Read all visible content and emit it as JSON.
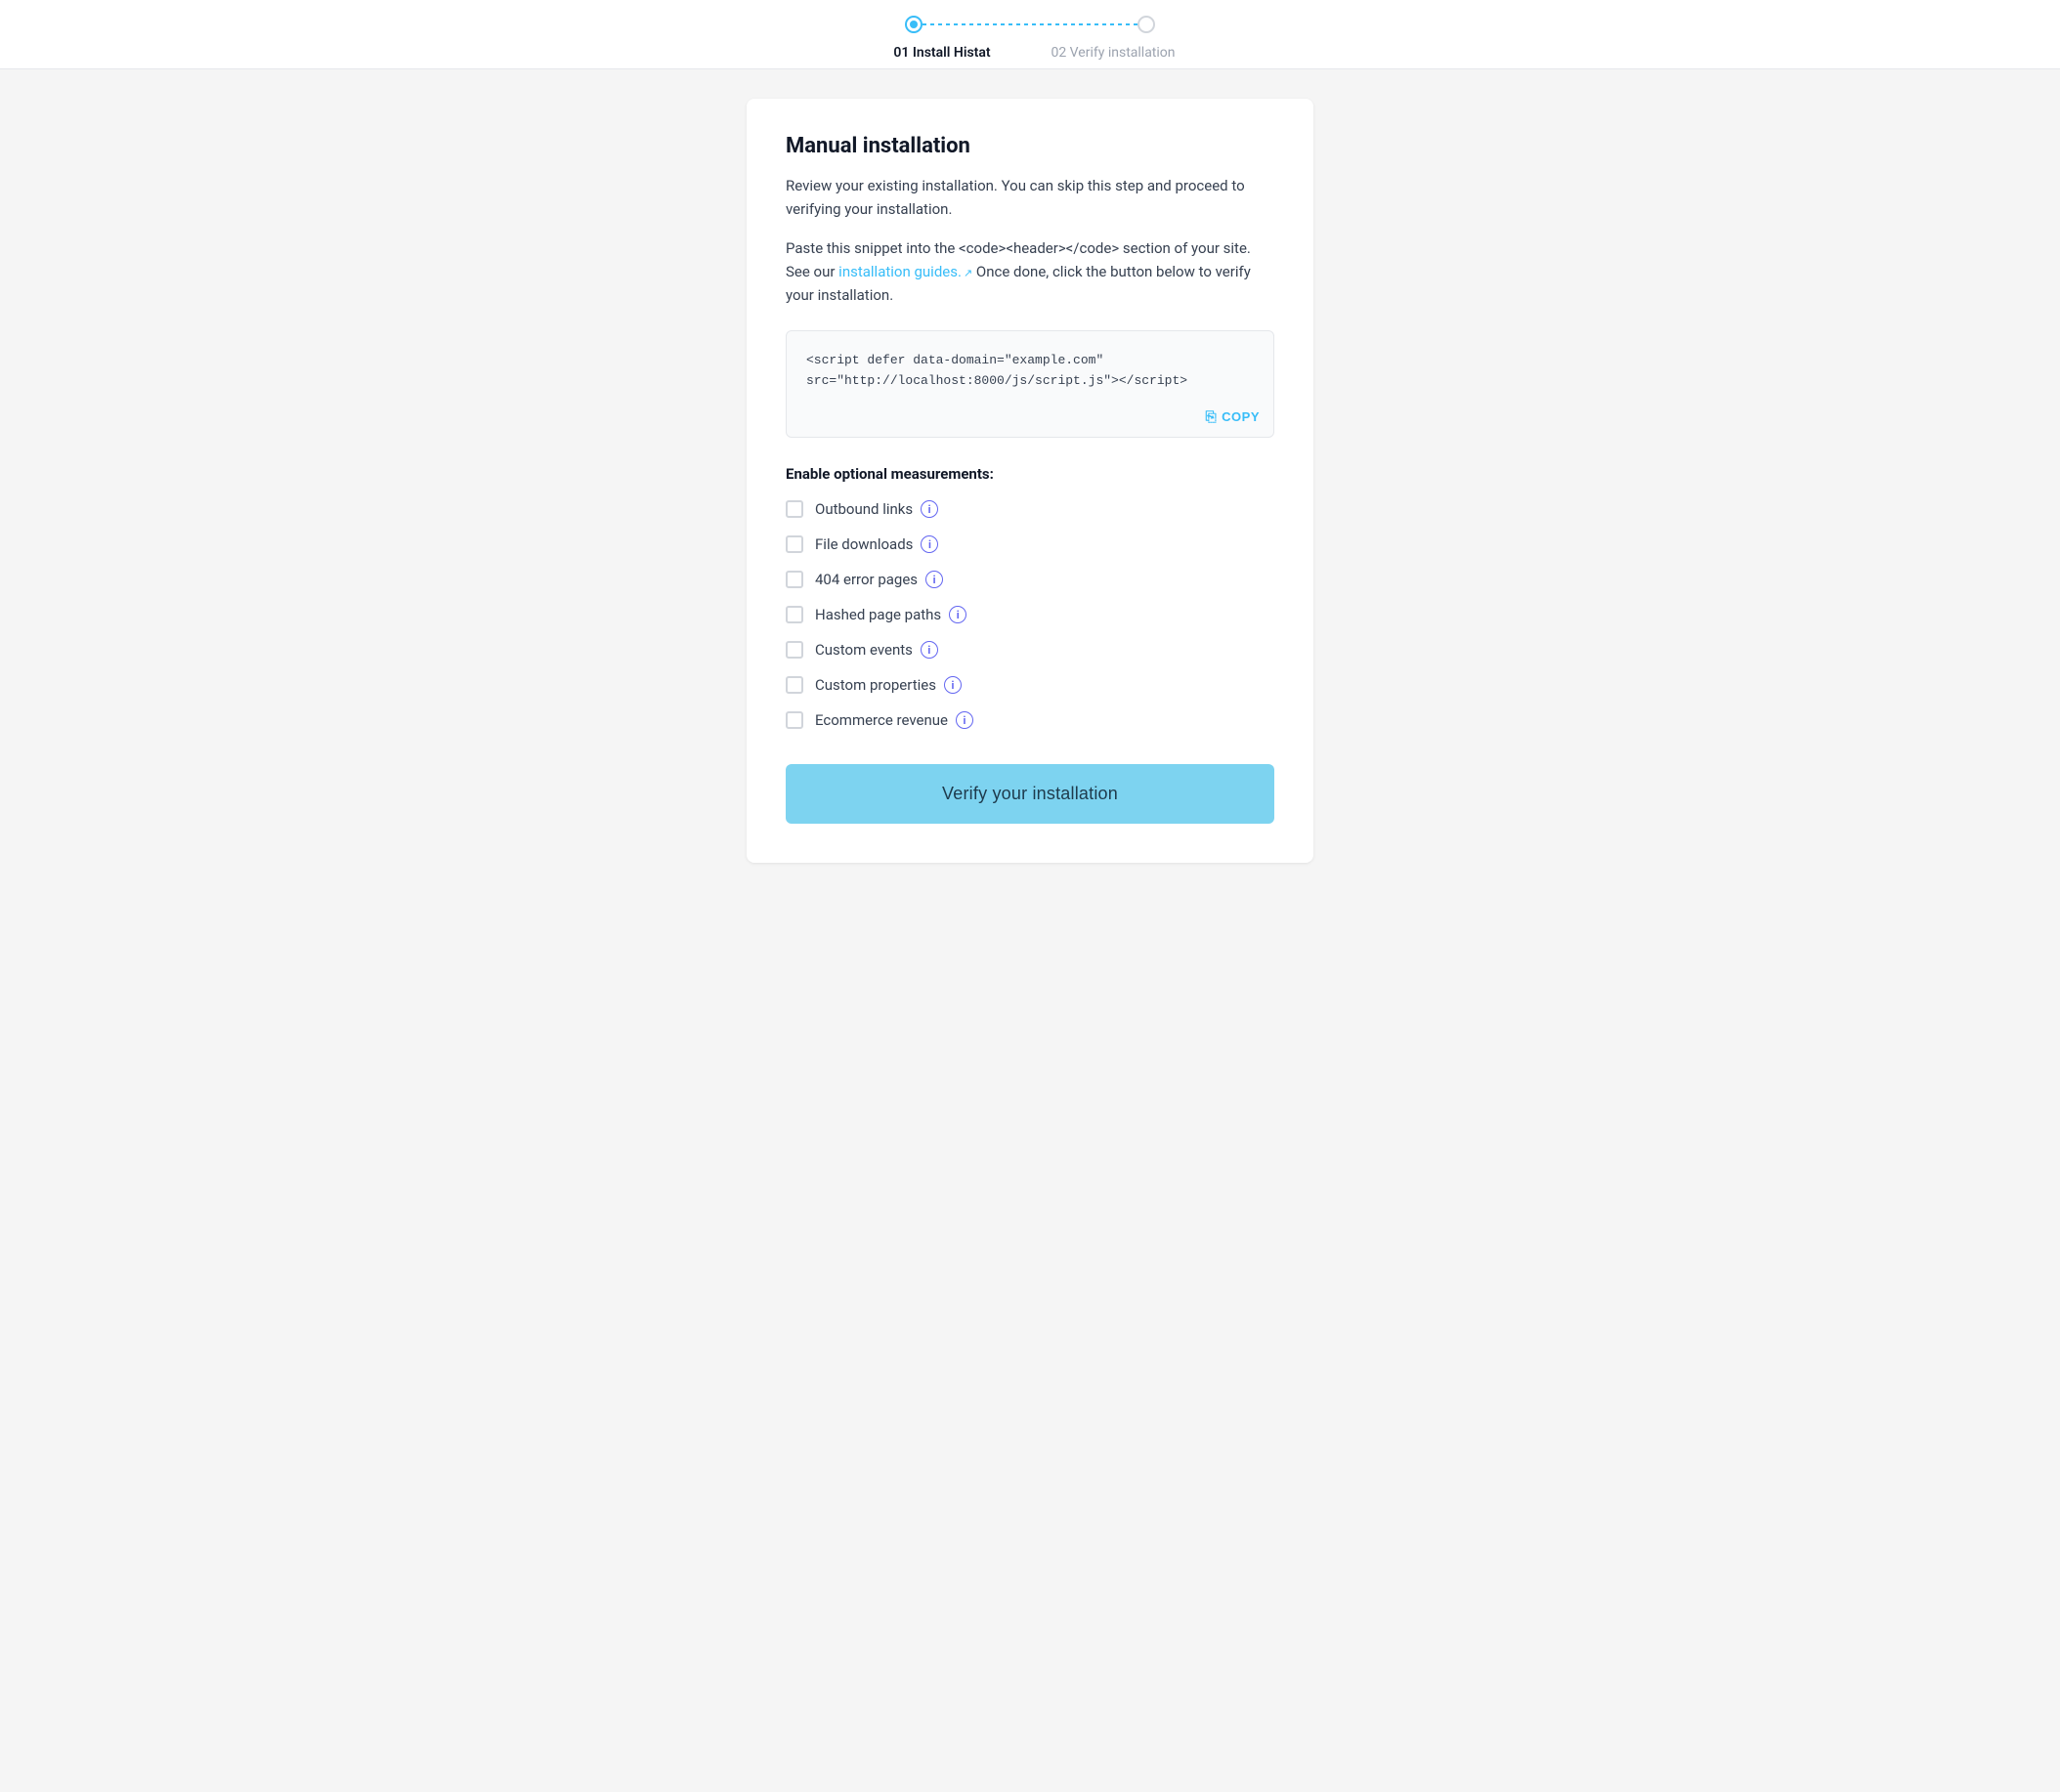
{
  "header": {
    "step1_label": "01 Install Histat",
    "step2_label": "02 Verify installation"
  },
  "card": {
    "title": "Manual installation",
    "desc1": "Review your existing installation. You can skip this step and proceed to verifying your installation.",
    "desc2_prefix": "Paste this snippet into the <code><header></code> section of your site. See our ",
    "desc2_link_text": "installation guides.",
    "desc2_suffix": " Once done, click the button below to verify your installation.",
    "code_snippet": "<script defer data-domain=\"example.com\"\nsrc=\"http://localhost:8000/js/script.js\"></script>",
    "copy_label": "COPY",
    "measurements_label": "Enable optional measurements:",
    "checkboxes": [
      {
        "id": "outbound",
        "label": "Outbound links"
      },
      {
        "id": "filedownloads",
        "label": "File downloads"
      },
      {
        "id": "404pages",
        "label": "404 error pages"
      },
      {
        "id": "hashed",
        "label": "Hashed page paths"
      },
      {
        "id": "customevents",
        "label": "Custom events"
      },
      {
        "id": "customprops",
        "label": "Custom properties"
      },
      {
        "id": "ecommerce",
        "label": "Ecommerce revenue"
      }
    ],
    "verify_button_label": "Verify your installation"
  }
}
